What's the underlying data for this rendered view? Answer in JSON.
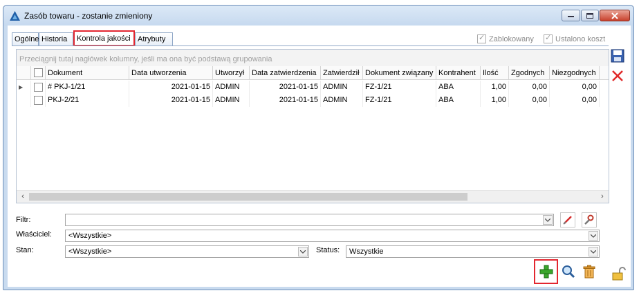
{
  "window": {
    "title": "Zasób towaru - zostanie zmieniony"
  },
  "tabs": [
    {
      "label": "Ogólne"
    },
    {
      "label": "Historia"
    },
    {
      "label": "Kontrola jakości"
    },
    {
      "label": "Atrybuty"
    }
  ],
  "flags": {
    "locked_label": "Zablokowany",
    "cost_label": "Ustalono koszt"
  },
  "grid": {
    "group_hint": "Przeciągnij tutaj nagłówek kolumny, jeśli ma ona być podstawą grupowania",
    "columns": [
      "Dokument",
      "Data utworzenia",
      "Utworzył",
      "Data zatwierdzenia",
      "Zatwierdził",
      "Dokument związany",
      "Kontrahent",
      "Ilość",
      "Zgodnych",
      "Niezgodnych"
    ],
    "rows": [
      {
        "doc": "# PKJ-1/21",
        "created": "2021-01-15",
        "created_by": "ADMIN",
        "approved": "2021-01-15",
        "approved_by": "ADMIN",
        "related": "FZ-1/21",
        "partner": "ABA",
        "qty": "1,00",
        "ok": "0,00",
        "nok": "0,00"
      },
      {
        "doc": "PKJ-2/21",
        "created": "2021-01-15",
        "created_by": "ADMIN",
        "approved": "2021-01-15",
        "approved_by": "ADMIN",
        "related": "FZ-1/21",
        "partner": "ABA",
        "qty": "1,00",
        "ok": "0,00",
        "nok": "0,00"
      }
    ]
  },
  "filters": {
    "filter_label": "Filtr:",
    "filter_value": "",
    "owner_label": "Właściciel:",
    "owner_value": "<Wszystkie>",
    "state_label": "Stan:",
    "state_value": "<Wszystkie>",
    "status_label": "Status:",
    "status_value": "Wszystkie"
  },
  "colors": {
    "accent_red": "#e3262f",
    "frame_blue": "#c9dbef"
  }
}
